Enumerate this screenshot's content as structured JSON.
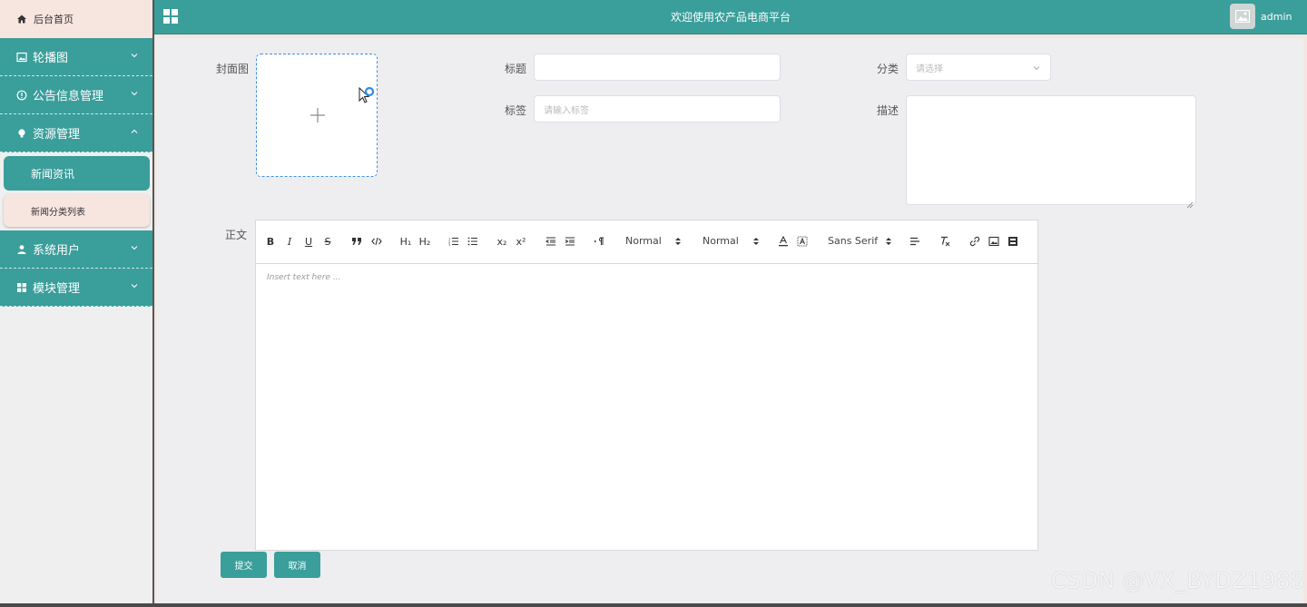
{
  "app": {
    "title": "欢迎使用农产品电商平台",
    "user": "admin",
    "accent_color": "#3a9e9b"
  },
  "sidebar": {
    "home": {
      "label": "后台首页",
      "icon": "home-icon"
    },
    "items": [
      {
        "label": "轮播图",
        "icon": "image-icon",
        "expanded": false
      },
      {
        "label": "公告信息管理",
        "icon": "info-icon",
        "expanded": false
      },
      {
        "label": "资源管理",
        "icon": "bulb-icon",
        "expanded": true
      },
      {
        "label": "系统用户",
        "icon": "user-icon",
        "expanded": false
      },
      {
        "label": "模块管理",
        "icon": "grid-icon",
        "expanded": false
      }
    ],
    "subitems": [
      {
        "label": "新闻资讯",
        "active": true
      },
      {
        "label": "新闻分类列表",
        "active": false
      }
    ]
  },
  "form": {
    "cover_label": "封面图",
    "title_label": "标题",
    "title_value": "",
    "category_label": "分类",
    "category_placeholder": "请选择",
    "tags_label": "标签",
    "tags_placeholder": "请输入标签",
    "desc_label": "描述",
    "content_label": "正文"
  },
  "editor": {
    "placeholder": "Insert text here ...",
    "size_picker": "Normal",
    "header_picker": "Normal",
    "font_picker": "Sans Serif",
    "buttons": {
      "h1": "H₁",
      "h2": "H₂",
      "sub": "x₂",
      "sup": "x²"
    }
  },
  "actions": {
    "submit_label": "提交",
    "cancel_label": "取消"
  },
  "watermark": "CSDN @VX_BYDZ1988"
}
